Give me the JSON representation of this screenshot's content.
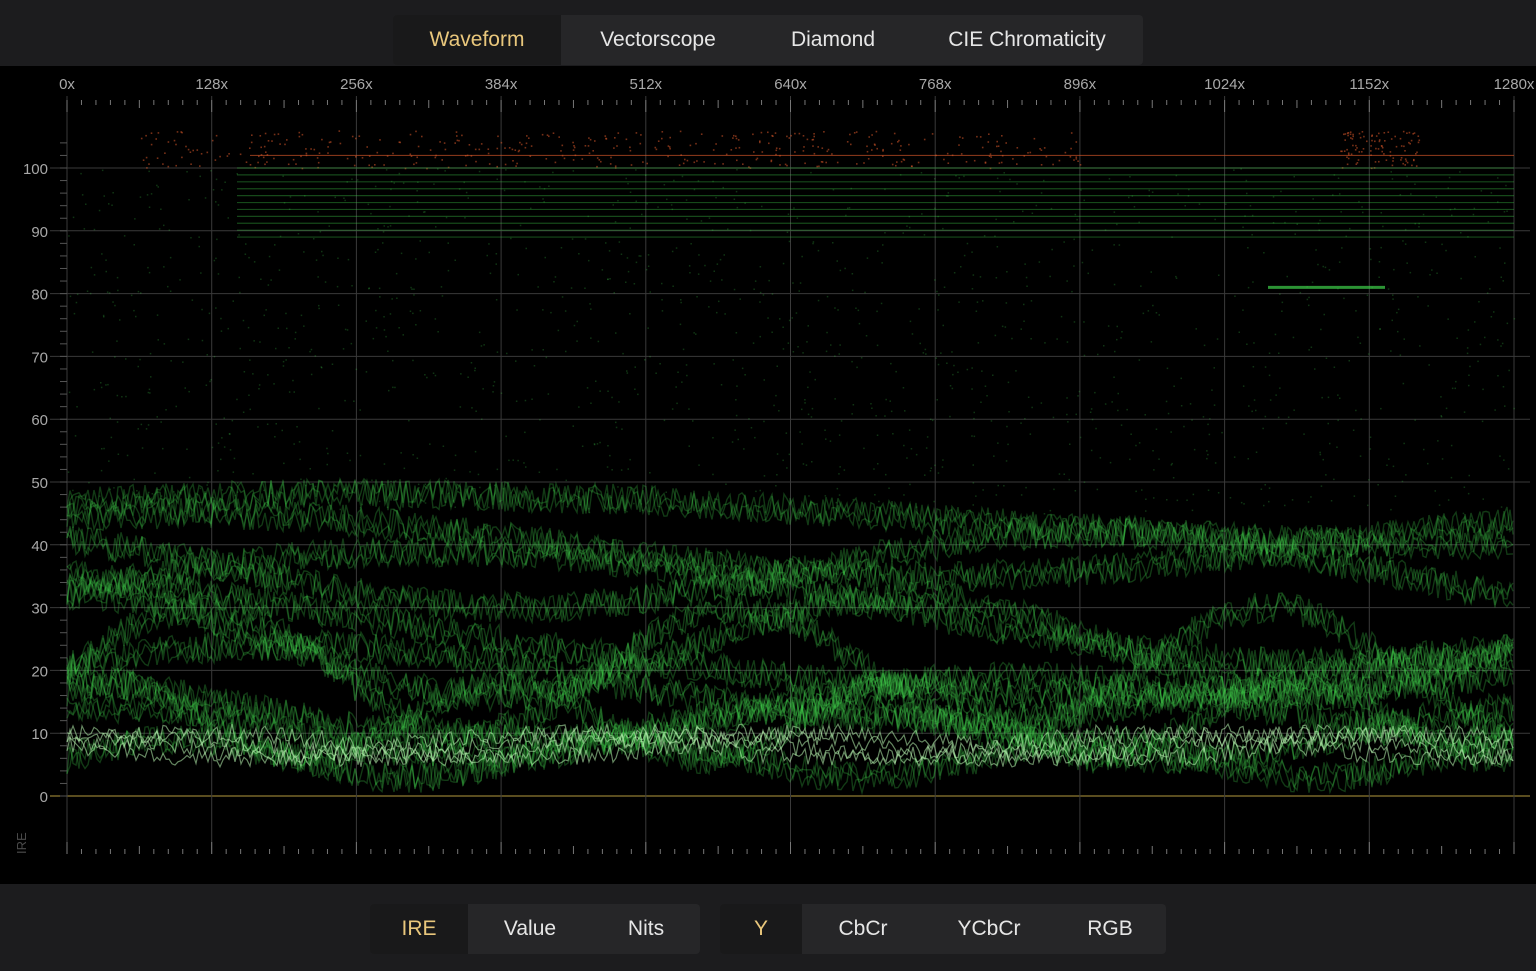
{
  "top_tabs": [
    {
      "label": "Waveform",
      "active": true
    },
    {
      "label": "Vectorscope",
      "active": false
    },
    {
      "label": "Diamond",
      "active": false
    },
    {
      "label": "CIE Chromaticity",
      "active": false
    }
  ],
  "scope": {
    "mode": "waveform",
    "x_axis_labels": [
      "0x",
      "128x",
      "256x",
      "384x",
      "512x",
      "640x",
      "768x",
      "896x",
      "1024x",
      "1152x",
      "1280x"
    ],
    "y_axis_labels": [
      "100",
      "90",
      "80",
      "70",
      "60",
      "50",
      "40",
      "30",
      "20",
      "10",
      "0"
    ],
    "y_axis_title": "IRE",
    "trace_color": "#3fd24a",
    "overshoot_color": "#d8582a",
    "zero_line_color": "#b59a3e",
    "grid_color": "#3a3a3a"
  },
  "units_tabs": [
    {
      "label": "IRE",
      "active": true
    },
    {
      "label": "Value",
      "active": false
    },
    {
      "label": "Nits",
      "active": false
    }
  ],
  "channel_tabs": [
    {
      "label": "Y",
      "active": true
    },
    {
      "label": "CbCr",
      "active": false
    },
    {
      "label": "YCbCr",
      "active": false
    },
    {
      "label": "RGB",
      "active": false
    }
  ],
  "accent_color": "#e9c77c"
}
